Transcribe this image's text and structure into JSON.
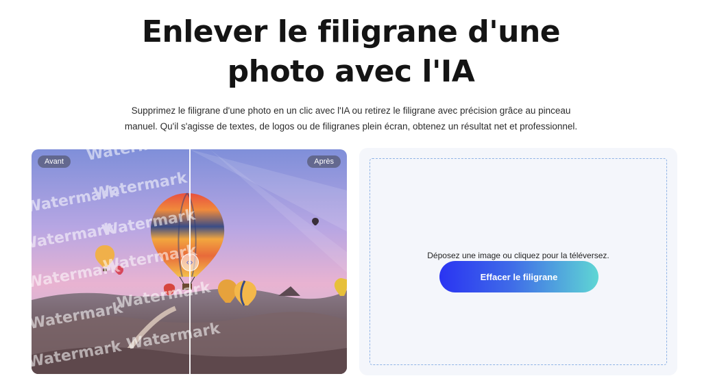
{
  "header": {
    "title_line1": "Enlever le filigrane d'une",
    "title_line2": "photo avec l'IA",
    "subtitle_line1": "Supprimez le filigrane d'une photo en un clic avec l'IA ou retirez le filigrane avec précision grâce au pinceau",
    "subtitle_line2": "manuel. Qu'il s'agisse de textes, de logos ou de filigranes plein écran, obtenez un résultat net et professionnel."
  },
  "comparison": {
    "before_label": "Avant",
    "after_label": "Après",
    "watermark_text": "Watermark",
    "handle_icon": "left-right-arrows-icon"
  },
  "upload": {
    "prompt": "Déposez une image ou cliquez pour la téléversez.",
    "button_label": "Effacer le filigrane"
  },
  "colors": {
    "button_gradient_start": "#2a34f2",
    "button_gradient_end": "#5fd6d4",
    "dropzone_border": "#8fb3e6",
    "card_background": "#f4f6fb"
  }
}
